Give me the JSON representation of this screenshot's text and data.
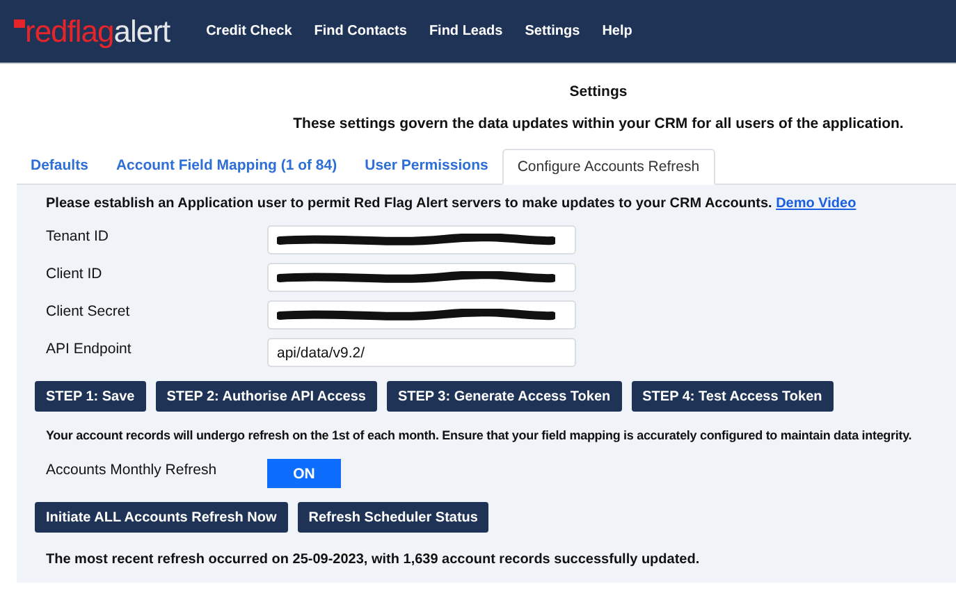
{
  "navbar": {
    "logo": [
      "redflag",
      "alert"
    ],
    "items": [
      {
        "label": "Credit Check"
      },
      {
        "label": "Find Contacts"
      },
      {
        "label": "Find Leads"
      },
      {
        "label": "Settings"
      },
      {
        "label": "Help"
      }
    ]
  },
  "page": {
    "title": "Settings",
    "subtitle": "These settings govern the data updates within your CRM for all users of the application."
  },
  "tabs": [
    {
      "label": "Defaults",
      "selected": false
    },
    {
      "label": "Account Field Mapping (1 of 84)",
      "selected": false
    },
    {
      "label": "User Permissions",
      "selected": false
    },
    {
      "label": "Configure Accounts Refresh",
      "selected": true
    }
  ],
  "panel": {
    "intro": "Please establish an Application user to permit Red Flag Alert servers to make updates to your CRM Accounts.",
    "intro_link": "Demo Video",
    "fields": [
      {
        "label": "Tenant ID",
        "redacted": true
      },
      {
        "label": "Client ID",
        "redacted": true
      },
      {
        "label": "Client Secret",
        "redacted": true
      },
      {
        "label": "API Endpoint",
        "redacted": false,
        "value": "api/data/v9.2/"
      }
    ],
    "step_buttons": [
      "STEP 1: Save",
      "STEP 2: Authorise API Access",
      "STEP 3: Generate Access Token",
      "STEP 4: Test Access Token"
    ],
    "notice": "Your account records will undergo refresh on the 1st of each month. Ensure that your field mapping is accurately configured to maintain data integrity.",
    "monthly_refresh": {
      "label": "Accounts Monthly Refresh",
      "on": true,
      "text": "ON"
    },
    "action_buttons": [
      "Initiate ALL Accounts Refresh Now",
      "Refresh Scheduler Status"
    ],
    "status": "The most recent refresh occurred on 25-09-2023, with 1,639 account records successfully updated."
  }
}
